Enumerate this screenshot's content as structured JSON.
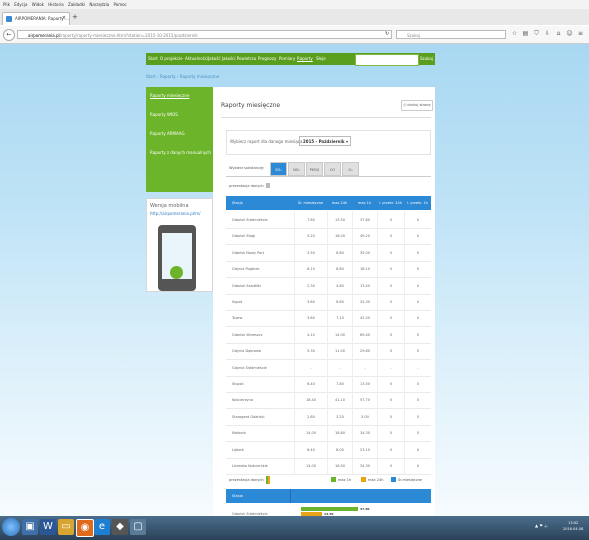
{
  "browser": {
    "menu": [
      "Plik",
      "Edycja",
      "Widok",
      "Historia",
      "Zakładki",
      "Narzędzia",
      "Pomoc"
    ],
    "tab_title": "AIRPOMERANIA: Raporty ...",
    "url_host": "airpomerania.pl",
    "url_path": "/raporty/raporty-miesieczne.html?station=2015-10-2015/pazdziernik",
    "search_placeholder": "Szukaj"
  },
  "site": {
    "nav": [
      "Start",
      "O projekcie",
      "Aktualności",
      "Jakość Jakości Powietrza",
      "Prognozy",
      "Pomiary",
      "Raporty",
      "Słoje"
    ],
    "search_button": "Szukaj",
    "breadcrumb": "Start  ›  Raporty  ›  Raporty miesięczne",
    "sidebar": [
      "Raporty miesięczne",
      "Raporty WIOS",
      "Raporty ARMAAG",
      "Raporty z danych manualnych"
    ],
    "mobile_title": "Wersja mobilna",
    "mobile_link": "http://airpomerania.pl/m/"
  },
  "main": {
    "title": "Raporty miesięczne",
    "print": "drukuj stronę",
    "select_label": "Wybierz raport dla danego miesiąca:",
    "select_value": "2015 - Październik",
    "substance_label": "Wybierz substancję:",
    "substances": [
      "SO₂",
      "NO₂",
      "PM10",
      "CO",
      "O₃"
    ],
    "data_label": "prezentacja danych:",
    "columns": [
      "Stacja",
      "Śr. miesięczne",
      "max 24h",
      "max 1h",
      "l. przekr. 24h",
      "l. przekr. 1h"
    ],
    "rows": [
      [
        "Gdańsk Śródmieście",
        "7.60",
        "13.50",
        "37.60",
        "0",
        "0"
      ],
      [
        "Gdańsk Stogi",
        "5.20",
        "18.00",
        "49.20",
        "0",
        "0"
      ],
      [
        "Gdańsk Nowy Port",
        "3.50",
        "6.80",
        "35.00",
        "0",
        "0"
      ],
      [
        "Gdynia Pogórze",
        "6.10",
        "8.80",
        "18.10",
        "0",
        "0"
      ],
      [
        "Gdańsk Szadółki",
        "2.30",
        "4.80",
        "13.40",
        "0",
        "0"
      ],
      [
        "Sopot",
        "3.60",
        "6.80",
        "25.30",
        "0",
        "0"
      ],
      [
        "Tczew",
        "3.60",
        "7.10",
        "42.50",
        "0",
        "0"
      ],
      [
        "Gdańsk Wrzeszcz",
        "4.10",
        "14.00",
        "69.40",
        "0",
        "0"
      ],
      [
        "Gdynia Dąbrowa",
        "5.30",
        "11.00",
        "29.60",
        "0",
        "0"
      ],
      [
        "Gdynia Śródmieście",
        "-",
        "-",
        "-",
        "-",
        "-"
      ],
      [
        "Słupsk",
        "6.40",
        "7.80",
        "13.50",
        "0",
        "0"
      ],
      [
        "Kościerzyna",
        "18.40",
        "41.10",
        "57.70",
        "0",
        "0"
      ],
      [
        "Starogard Gdański",
        "2.80",
        "3.20",
        "5.00",
        "0",
        "0"
      ],
      [
        "Malbork",
        "14.00",
        "18.60",
        "34.30",
        "0",
        "0"
      ],
      [
        "Lębork",
        "6.40",
        "8.00",
        "23.10",
        "0",
        "0"
      ],
      [
        "Liniewko Kościerskie",
        "14.00",
        "16.50",
        "34.30",
        "0",
        "0"
      ]
    ],
    "legend": [
      "max 1h",
      "max 24h",
      "Śr.miesięczne"
    ],
    "chart_header": "Stacja",
    "chart_first": "Gdańsk Śródmieście",
    "chart_v1": "37.60",
    "chart_v2": "13.50",
    "chart_values": [
      37.6,
      13.5
    ]
  },
  "taskbar": {
    "tray": "▲ ⚑ 🔈",
    "time": "13:02",
    "date": "2016-04-08"
  }
}
